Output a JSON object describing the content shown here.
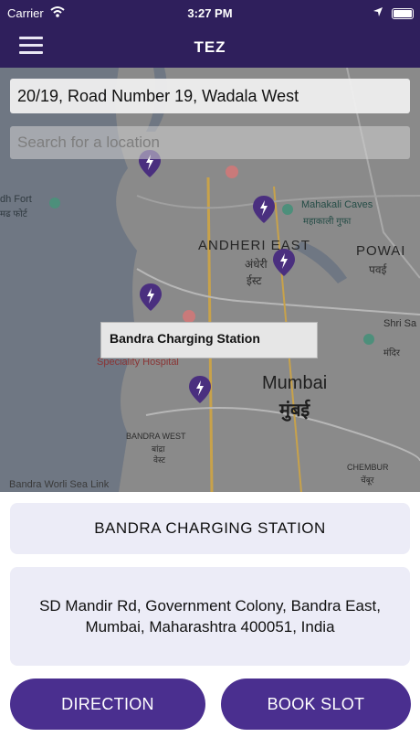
{
  "status_bar": {
    "carrier": "Carrier",
    "time": "3:27 PM"
  },
  "nav": {
    "title": "TEZ"
  },
  "address_bar": {
    "value": "20/19, Road Number 19, Wadala West"
  },
  "search": {
    "placeholder": "Search for a location"
  },
  "map": {
    "labels": {
      "fort": "dh Fort",
      "fort_local": "मढ फोर्ट",
      "mahakali": "Mahakali Caves",
      "mahakali_local": "महाकाली गुफा",
      "andheri": "ANDHERI EAST",
      "andheri_local_1": "अंधेरी",
      "andheri_local_2": "ईस्ट",
      "powai": "POWAI",
      "powai_local": "पवई",
      "shri_sa": "Shri Sa",
      "shri_local": "मंदिर",
      "speciality": "Speciality Hospital",
      "mumbai": "Mumbai",
      "mumbai_local": "मुंबई",
      "bandra_west": "BANDRA WEST",
      "bandra_local_1": "बांद्रा",
      "bandra_local_2": "वेस्ट",
      "chembur": "CHEMBUR",
      "chembur_local": "चेंबूर",
      "sealink": "Bandra Worli Sea Link"
    },
    "callout": "Bandra Charging Station"
  },
  "station": {
    "name": "BANDRA CHARGING STATION",
    "address_line1": "SD Mandir Rd, Government Colony, Bandra East,",
    "address_line2": "Mumbai, Maharashtra 400051, India"
  },
  "actions": {
    "direction": "DIRECTION",
    "book_slot": "BOOK SLOT"
  },
  "colors": {
    "header": "#2f1f5c",
    "button": "#4a2f8f",
    "card": "#ececf7",
    "pin": "#5b3a99"
  },
  "icons": {
    "menu": "hamburger-menu-icon",
    "pin": "charging-station-pin-icon",
    "wifi": "wifi-icon",
    "location": "location-arrow-icon",
    "battery": "battery-icon"
  }
}
